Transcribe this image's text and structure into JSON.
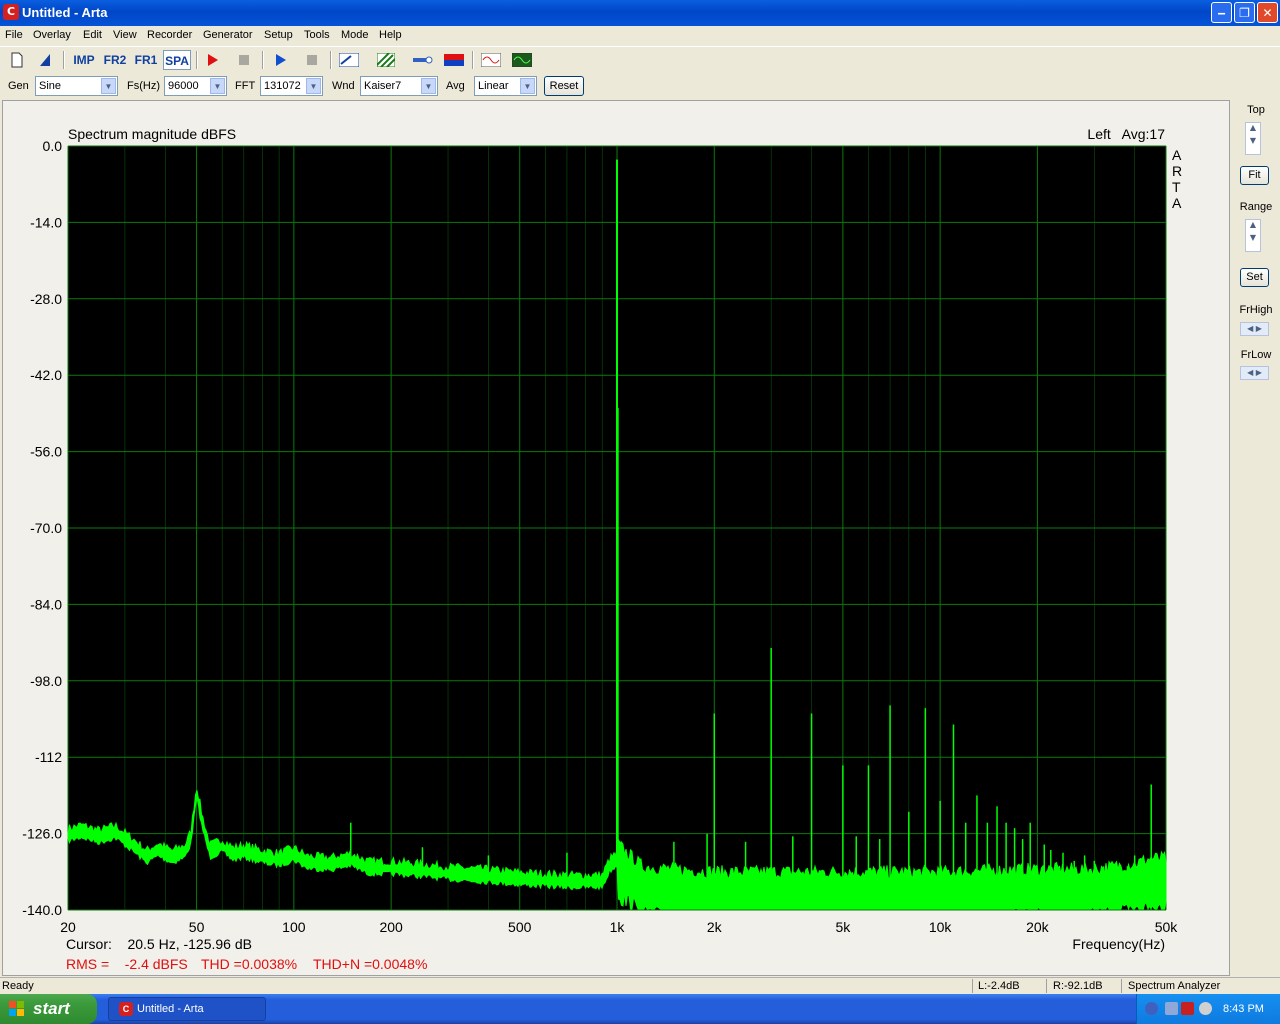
{
  "window": {
    "title": "Untitled - Arta",
    "app_icon_letter": "C"
  },
  "menu": [
    "File",
    "Overlay",
    "Edit",
    "View",
    "Recorder",
    "Generator",
    "Setup",
    "Tools",
    "Mode",
    "Help"
  ],
  "toolbar": {
    "imp_label": "IMP",
    "fr2_label": "FR2",
    "fr1_label": "FR1",
    "spa_label": "SPA"
  },
  "params": {
    "gen_label": "Gen",
    "gen_value": "Sine",
    "fs_label": "Fs(Hz)",
    "fs_value": "96000",
    "fft_label": "FFT",
    "fft_value": "131072",
    "wnd_label": "Wnd",
    "wnd_value": "Kaiser7",
    "avg_label": "Avg",
    "avg_value": "Linear",
    "reset_label": "Reset"
  },
  "right_panel": {
    "top_label": "Top",
    "fit_label": "Fit",
    "range_label": "Range",
    "set_label": "Set",
    "frhigh_label": "FrHigh",
    "frlow_label": "FrLow"
  },
  "plot": {
    "channel_avg": "Left   Avg:17",
    "watermark": "ARTA",
    "cursor": "Cursor:    20.5 Hz, -125.96 dB",
    "rms": "RMS =    -2.4 dBFS",
    "thd": "THD =0.0038%",
    "thdn": "THD+N =0.0048%"
  },
  "chart_data": {
    "type": "line",
    "title": "Spectrum magnitude dBFS",
    "xlabel": "Frequency(Hz)",
    "ylabel": "",
    "x_scale": "log",
    "xlim": [
      20,
      50000
    ],
    "ylim": [
      -140,
      0
    ],
    "grid": true,
    "x_ticks": [
      "20",
      "50",
      "100",
      "200",
      "500",
      "1k",
      "2k",
      "5k",
      "10k",
      "20k",
      "50k"
    ],
    "y_ticks": [
      "0.0",
      "-14.0",
      "-28.0",
      "-42.0",
      "-56.0",
      "-70.0",
      "-84.0",
      "-98.0",
      "-112",
      "-126.0",
      "-140.0"
    ],
    "y_tick_values": [
      0,
      -14,
      -28,
      -42,
      -56,
      -70,
      -84,
      -98,
      -112,
      -126,
      -140
    ],
    "x_tick_values": [
      20,
      50,
      100,
      200,
      500,
      1000,
      2000,
      5000,
      10000,
      20000,
      50000
    ],
    "line_color": "#00ff00",
    "background": "#000000",
    "grid_color": "#0a7a0a",
    "noise_floor": [
      [
        20,
        -126.5
      ],
      [
        22,
        -125.8
      ],
      [
        25,
        -126.8
      ],
      [
        28,
        -125.9
      ],
      [
        32,
        -128.5
      ],
      [
        35,
        -130.5
      ],
      [
        38,
        -129.2
      ],
      [
        42,
        -130.5
      ],
      [
        46,
        -129.5
      ],
      [
        48,
        -127
      ],
      [
        50,
        -118.5
      ],
      [
        52,
        -124
      ],
      [
        55,
        -129.5
      ],
      [
        60,
        -128.5
      ],
      [
        65,
        -130
      ],
      [
        70,
        -129.5
      ],
      [
        80,
        -130.5
      ],
      [
        90,
        -131
      ],
      [
        100,
        -130
      ],
      [
        110,
        -131.5
      ],
      [
        130,
        -131.8
      ],
      [
        150,
        -131
      ],
      [
        170,
        -132.5
      ],
      [
        200,
        -132.5
      ],
      [
        250,
        -133
      ],
      [
        300,
        -133.5
      ],
      [
        400,
        -134
      ],
      [
        500,
        -134.5
      ],
      [
        700,
        -135
      ],
      [
        900,
        -135
      ],
      [
        950,
        -132
      ],
      [
        1000,
        -131
      ],
      [
        1050,
        -132.5
      ],
      [
        1200,
        -135.5
      ],
      [
        1500,
        -136
      ],
      [
        2000,
        -136.5
      ],
      [
        3000,
        -136.5
      ],
      [
        5000,
        -136.5
      ],
      [
        10000,
        -136.5
      ],
      [
        20000,
        -136
      ],
      [
        30000,
        -136
      ],
      [
        40000,
        -135
      ],
      [
        45000,
        -134
      ],
      [
        50000,
        -134
      ]
    ],
    "peaks": [
      [
        50,
        -118.5
      ],
      [
        150,
        -124
      ],
      [
        250,
        -128.5
      ],
      [
        400,
        -130
      ],
      [
        700,
        -129.5
      ],
      [
        1000,
        -2.5
      ],
      [
        1005,
        -48
      ],
      [
        1500,
        -127.5
      ],
      [
        1900,
        -126
      ],
      [
        2000,
        -104
      ],
      [
        2500,
        -127.5
      ],
      [
        3000,
        -92
      ],
      [
        3500,
        -126.5
      ],
      [
        4000,
        -104
      ],
      [
        5000,
        -113.5
      ],
      [
        5500,
        -126.5
      ],
      [
        6000,
        -113.5
      ],
      [
        6500,
        -127
      ],
      [
        7000,
        -102.5
      ],
      [
        8000,
        -122
      ],
      [
        9000,
        -103
      ],
      [
        10000,
        -120
      ],
      [
        11000,
        -106
      ],
      [
        12000,
        -124
      ],
      [
        13000,
        -119
      ],
      [
        14000,
        -124
      ],
      [
        15000,
        -121
      ],
      [
        16000,
        -124
      ],
      [
        17000,
        -125
      ],
      [
        18000,
        -127
      ],
      [
        19000,
        -124
      ],
      [
        21000,
        -128
      ],
      [
        22000,
        -129
      ],
      [
        24000,
        -129.5
      ],
      [
        26000,
        -131
      ],
      [
        28000,
        -130
      ],
      [
        30000,
        -131
      ],
      [
        32000,
        -132
      ],
      [
        35000,
        -131.5
      ],
      [
        38000,
        -132
      ],
      [
        40000,
        -130
      ],
      [
        45000,
        -117
      ]
    ]
  },
  "status": {
    "left": "Ready",
    "l_level": "L:-2.4dB",
    "r_level": "R:-92.1dB",
    "mode": "Spectrum Analyzer"
  },
  "taskbar": {
    "start_label": "start",
    "item_label": "Untitled - Arta",
    "clock": "8:43 PM"
  }
}
